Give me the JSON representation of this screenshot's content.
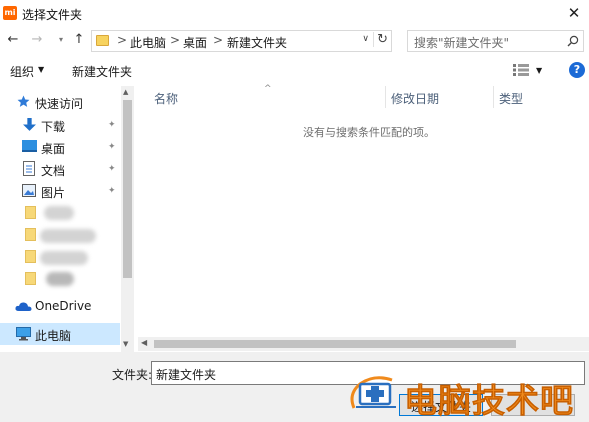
{
  "window": {
    "title": "选择文件夹",
    "app_icon_text": "mi",
    "close_glyph": "✕"
  },
  "nav": {
    "back_glyph": "←",
    "forward_glyph": "→",
    "recent_glyph": "▾",
    "up_glyph": "↑",
    "breadcrumbs": [
      "此电脑",
      "桌面",
      "新建文件夹"
    ],
    "separator": ">",
    "dropdown_glyph": "∨",
    "refresh_glyph": "↻",
    "search_placeholder": "搜索\"新建文件夹\""
  },
  "toolbar": {
    "organize_label": "组织",
    "caret": "▼",
    "new_folder_label": "新建文件夹",
    "help_glyph": "?"
  },
  "sidebar": {
    "items": [
      {
        "label": "快速访问",
        "icon": "star-icon"
      },
      {
        "label": "下载",
        "icon": "download-icon",
        "pinned": true
      },
      {
        "label": "桌面",
        "icon": "desktop-icon",
        "pinned": true
      },
      {
        "label": "文档",
        "icon": "document-icon",
        "pinned": true
      },
      {
        "label": "图片",
        "icon": "picture-icon",
        "pinned": true
      },
      {
        "label": "OneDrive",
        "icon": "cloud-icon"
      },
      {
        "label": "此电脑",
        "icon": "computer-icon",
        "selected": true
      }
    ],
    "pin_glyph": "📌",
    "scroll_up": "▲",
    "scroll_down": "▼"
  },
  "columns": {
    "name": "名称",
    "modified": "修改日期",
    "type": "类型",
    "sort_glyph": "^"
  },
  "empty_message": "没有与搜索条件匹配的项。",
  "hscroll_left": "◀",
  "footer": {
    "folder_label": "文件夹:",
    "folder_value": "新建文件夹",
    "select_button": "选择文件夹"
  },
  "watermark": {
    "text": "电脑技术吧"
  },
  "colors": {
    "accent": "#0078d7",
    "selected_bg": "#cce8ff",
    "watermark": "#f08a1c",
    "help": "#1c6ad6"
  }
}
